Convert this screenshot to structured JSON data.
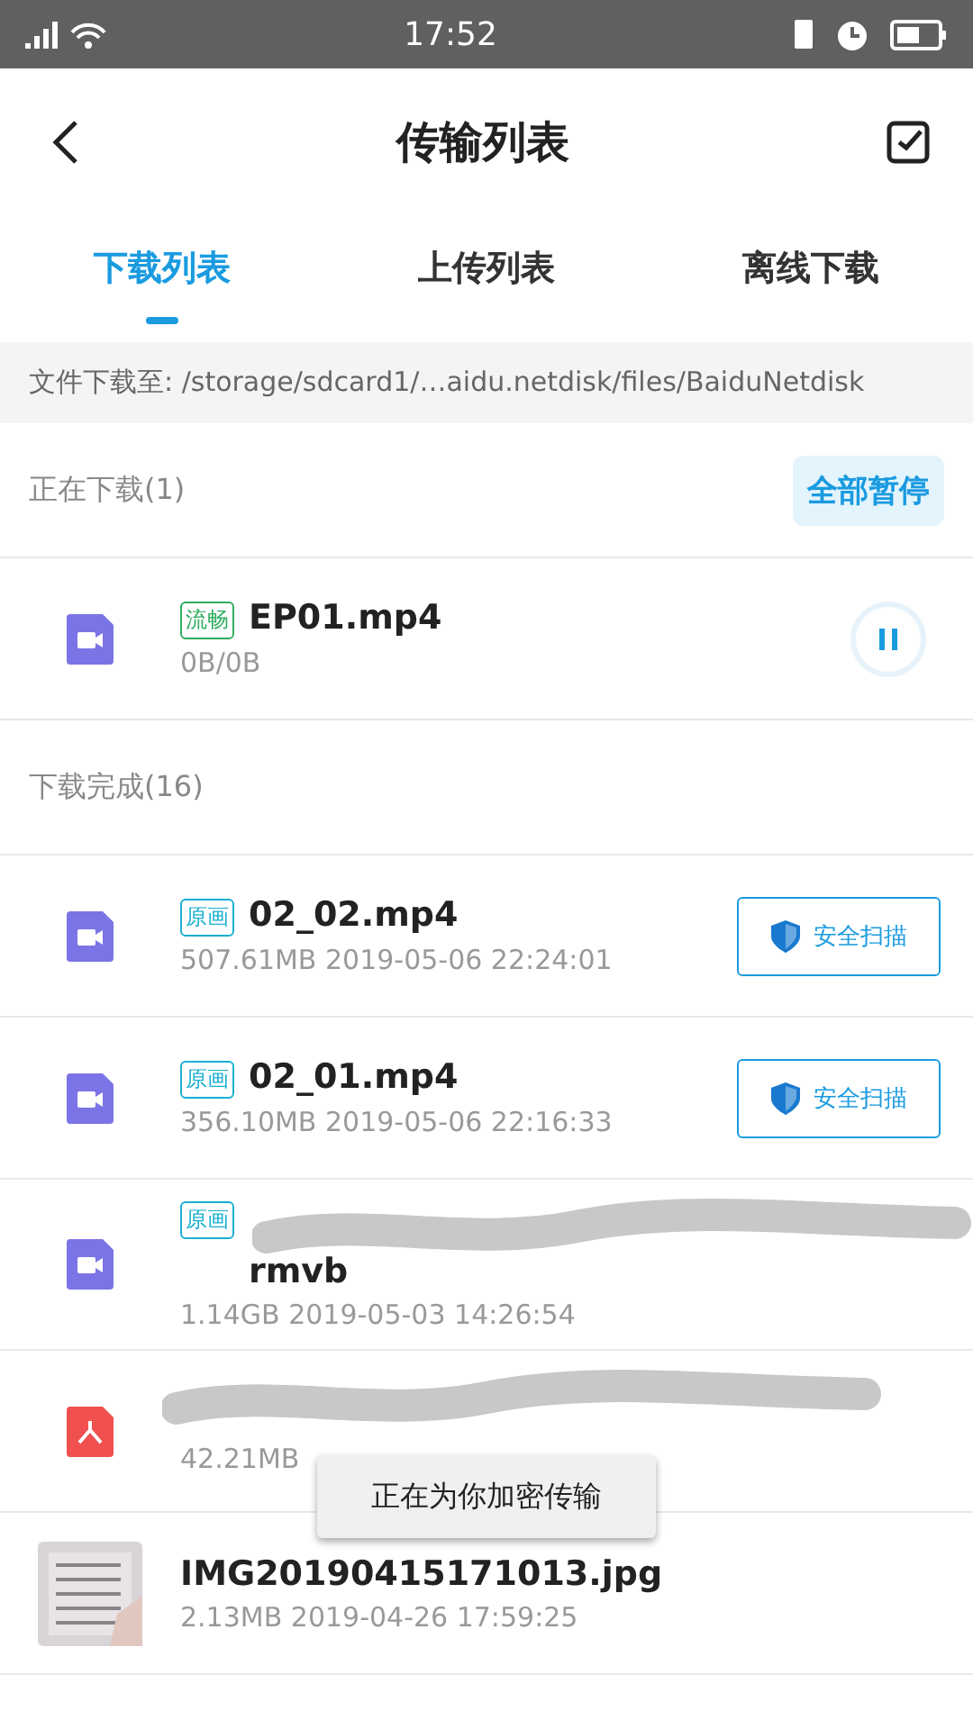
{
  "status_bar": {
    "time": "17:52"
  },
  "header": {
    "title": "传输列表"
  },
  "tabs": [
    {
      "label": "下载列表",
      "selected": true
    },
    {
      "label": "上传列表",
      "selected": false
    },
    {
      "label": "离线下载",
      "selected": false
    }
  ],
  "path_bar": {
    "text": "文件下载至: /storage/sdcard1/…aidu.netdisk/files/BaiduNetdisk"
  },
  "sections": [
    {
      "title": "正在下载(1)",
      "button": "全部暂停",
      "items": [
        {
          "kind": "video",
          "tag": {
            "label": "流畅",
            "color": "#2fae5f"
          },
          "name": "EP01.mp4",
          "meta": "0B/0B",
          "action": {
            "kind": "pause"
          }
        }
      ]
    },
    {
      "title": "下载完成(16)",
      "items": [
        {
          "kind": "video",
          "tag": {
            "label": "原画",
            "color": "#1ab0d0"
          },
          "name": "02_02.mp4",
          "meta": "507.61MB 2019-05-06 22:24:01",
          "action": {
            "kind": "scan",
            "label": "安全扫描"
          }
        },
        {
          "kind": "video",
          "tag": {
            "label": "原画",
            "color": "#1ab0d0"
          },
          "name": "02_01.mp4",
          "meta": "356.10MB 2019-05-06 22:16:33",
          "action": {
            "kind": "scan",
            "label": "安全扫描"
          }
        },
        {
          "kind": "video",
          "tag": {
            "label": "原画",
            "color": "#1ab0d0"
          },
          "redacted": true,
          "name": "rmvb",
          "meta": "1.14GB 2019-05-03 14:26:54"
        },
        {
          "kind": "pdf",
          "redacted": true,
          "meta": "42.21MB"
        },
        {
          "name": "IMG20190415171013.jpg",
          "meta": "2.13MB 2019-04-26 17:59:25"
        }
      ]
    }
  ],
  "toast": {
    "text": "正在为你加密传输"
  }
}
